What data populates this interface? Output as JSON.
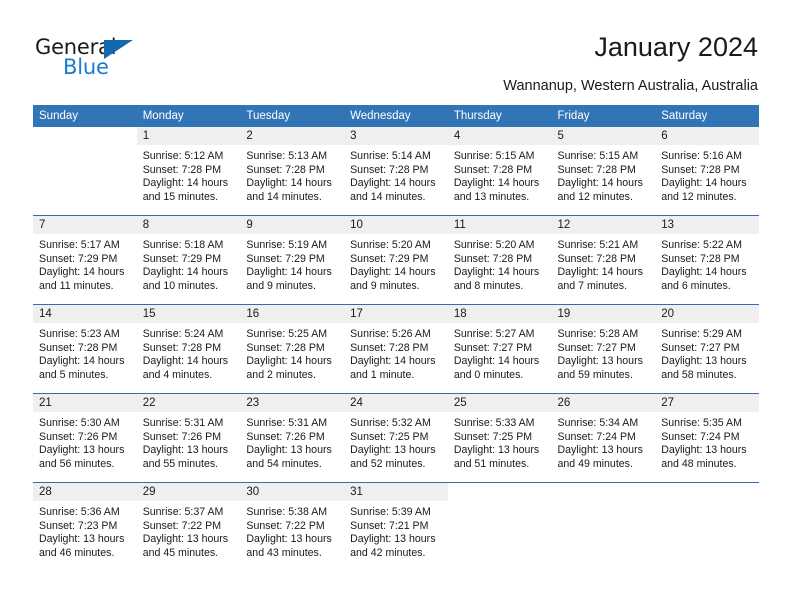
{
  "brand": {
    "name_part1": "General",
    "name_part2": "Blue",
    "triangle_icon": "triangle-icon",
    "accent_dark": "#1568b0",
    "accent_blue": "#1b7ad1"
  },
  "header": {
    "title": "January 2024",
    "location": "Wannanup, Western Australia, Australia"
  },
  "theme": {
    "header_blue": "#3275b6",
    "separator_blue": "#2f6fae",
    "band_gray": "#efefef"
  },
  "weekday_headers": [
    "Sunday",
    "Monday",
    "Tuesday",
    "Wednesday",
    "Thursday",
    "Friday",
    "Saturday"
  ],
  "weeks": [
    [
      {
        "day": "",
        "lines": []
      },
      {
        "day": "1",
        "lines": [
          "Sunrise: 5:12 AM",
          "Sunset: 7:28 PM",
          "Daylight: 14 hours",
          "and 15 minutes."
        ]
      },
      {
        "day": "2",
        "lines": [
          "Sunrise: 5:13 AM",
          "Sunset: 7:28 PM",
          "Daylight: 14 hours",
          "and 14 minutes."
        ]
      },
      {
        "day": "3",
        "lines": [
          "Sunrise: 5:14 AM",
          "Sunset: 7:28 PM",
          "Daylight: 14 hours",
          "and 14 minutes."
        ]
      },
      {
        "day": "4",
        "lines": [
          "Sunrise: 5:15 AM",
          "Sunset: 7:28 PM",
          "Daylight: 14 hours",
          "and 13 minutes."
        ]
      },
      {
        "day": "5",
        "lines": [
          "Sunrise: 5:15 AM",
          "Sunset: 7:28 PM",
          "Daylight: 14 hours",
          "and 12 minutes."
        ]
      },
      {
        "day": "6",
        "lines": [
          "Sunrise: 5:16 AM",
          "Sunset: 7:28 PM",
          "Daylight: 14 hours",
          "and 12 minutes."
        ]
      }
    ],
    [
      {
        "day": "7",
        "lines": [
          "Sunrise: 5:17 AM",
          "Sunset: 7:29 PM",
          "Daylight: 14 hours",
          "and 11 minutes."
        ]
      },
      {
        "day": "8",
        "lines": [
          "Sunrise: 5:18 AM",
          "Sunset: 7:29 PM",
          "Daylight: 14 hours",
          "and 10 minutes."
        ]
      },
      {
        "day": "9",
        "lines": [
          "Sunrise: 5:19 AM",
          "Sunset: 7:29 PM",
          "Daylight: 14 hours",
          "and 9 minutes."
        ]
      },
      {
        "day": "10",
        "lines": [
          "Sunrise: 5:20 AM",
          "Sunset: 7:29 PM",
          "Daylight: 14 hours",
          "and 9 minutes."
        ]
      },
      {
        "day": "11",
        "lines": [
          "Sunrise: 5:20 AM",
          "Sunset: 7:28 PM",
          "Daylight: 14 hours",
          "and 8 minutes."
        ]
      },
      {
        "day": "12",
        "lines": [
          "Sunrise: 5:21 AM",
          "Sunset: 7:28 PM",
          "Daylight: 14 hours",
          "and 7 minutes."
        ]
      },
      {
        "day": "13",
        "lines": [
          "Sunrise: 5:22 AM",
          "Sunset: 7:28 PM",
          "Daylight: 14 hours",
          "and 6 minutes."
        ]
      }
    ],
    [
      {
        "day": "14",
        "lines": [
          "Sunrise: 5:23 AM",
          "Sunset: 7:28 PM",
          "Daylight: 14 hours",
          "and 5 minutes."
        ]
      },
      {
        "day": "15",
        "lines": [
          "Sunrise: 5:24 AM",
          "Sunset: 7:28 PM",
          "Daylight: 14 hours",
          "and 4 minutes."
        ]
      },
      {
        "day": "16",
        "lines": [
          "Sunrise: 5:25 AM",
          "Sunset: 7:28 PM",
          "Daylight: 14 hours",
          "and 2 minutes."
        ]
      },
      {
        "day": "17",
        "lines": [
          "Sunrise: 5:26 AM",
          "Sunset: 7:28 PM",
          "Daylight: 14 hours",
          "and 1 minute."
        ]
      },
      {
        "day": "18",
        "lines": [
          "Sunrise: 5:27 AM",
          "Sunset: 7:27 PM",
          "Daylight: 14 hours",
          "and 0 minutes."
        ]
      },
      {
        "day": "19",
        "lines": [
          "Sunrise: 5:28 AM",
          "Sunset: 7:27 PM",
          "Daylight: 13 hours",
          "and 59 minutes."
        ]
      },
      {
        "day": "20",
        "lines": [
          "Sunrise: 5:29 AM",
          "Sunset: 7:27 PM",
          "Daylight: 13 hours",
          "and 58 minutes."
        ]
      }
    ],
    [
      {
        "day": "21",
        "lines": [
          "Sunrise: 5:30 AM",
          "Sunset: 7:26 PM",
          "Daylight: 13 hours",
          "and 56 minutes."
        ]
      },
      {
        "day": "22",
        "lines": [
          "Sunrise: 5:31 AM",
          "Sunset: 7:26 PM",
          "Daylight: 13 hours",
          "and 55 minutes."
        ]
      },
      {
        "day": "23",
        "lines": [
          "Sunrise: 5:31 AM",
          "Sunset: 7:26 PM",
          "Daylight: 13 hours",
          "and 54 minutes."
        ]
      },
      {
        "day": "24",
        "lines": [
          "Sunrise: 5:32 AM",
          "Sunset: 7:25 PM",
          "Daylight: 13 hours",
          "and 52 minutes."
        ]
      },
      {
        "day": "25",
        "lines": [
          "Sunrise: 5:33 AM",
          "Sunset: 7:25 PM",
          "Daylight: 13 hours",
          "and 51 minutes."
        ]
      },
      {
        "day": "26",
        "lines": [
          "Sunrise: 5:34 AM",
          "Sunset: 7:24 PM",
          "Daylight: 13 hours",
          "and 49 minutes."
        ]
      },
      {
        "day": "27",
        "lines": [
          "Sunrise: 5:35 AM",
          "Sunset: 7:24 PM",
          "Daylight: 13 hours",
          "and 48 minutes."
        ]
      }
    ],
    [
      {
        "day": "28",
        "lines": [
          "Sunrise: 5:36 AM",
          "Sunset: 7:23 PM",
          "Daylight: 13 hours",
          "and 46 minutes."
        ]
      },
      {
        "day": "29",
        "lines": [
          "Sunrise: 5:37 AM",
          "Sunset: 7:22 PM",
          "Daylight: 13 hours",
          "and 45 minutes."
        ]
      },
      {
        "day": "30",
        "lines": [
          "Sunrise: 5:38 AM",
          "Sunset: 7:22 PM",
          "Daylight: 13 hours",
          "and 43 minutes."
        ]
      },
      {
        "day": "31",
        "lines": [
          "Sunrise: 5:39 AM",
          "Sunset: 7:21 PM",
          "Daylight: 13 hours",
          "and 42 minutes."
        ]
      },
      {
        "day": "",
        "lines": []
      },
      {
        "day": "",
        "lines": []
      },
      {
        "day": "",
        "lines": []
      }
    ]
  ]
}
